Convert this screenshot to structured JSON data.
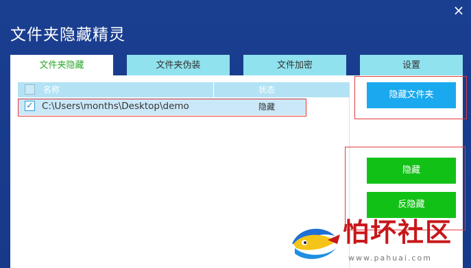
{
  "window": {
    "title": "文件夹隐藏精灵",
    "close_glyph": "×"
  },
  "tabs": [
    {
      "label": "文件夹隐藏",
      "active": true
    },
    {
      "label": "文件夹伪装",
      "active": false
    },
    {
      "label": "文件加密",
      "active": false
    },
    {
      "label": "设置",
      "active": false
    }
  ],
  "list": {
    "columns": {
      "name": "名称",
      "status": "状态"
    },
    "rows": [
      {
        "checked": true,
        "check_glyph": "✓",
        "path": "C:\\Users\\months\\Desktop\\demo",
        "status": "隐藏"
      }
    ]
  },
  "buttons": {
    "hide_folder": "隐藏文件夹",
    "hide": "隐藏",
    "unhide": "反隐藏"
  },
  "watermark": {
    "text": "怕坏社区",
    "url": "www.pahuai.com"
  },
  "colors": {
    "window_bg": "#1a3f8e",
    "tab_bg": "#8fe2ee",
    "active_tab_text": "#2ba42b",
    "blue_button": "#1aa9ee",
    "green_button": "#12c116",
    "highlight_box": "#e23a3a",
    "watermark_red": "#c8171a"
  }
}
